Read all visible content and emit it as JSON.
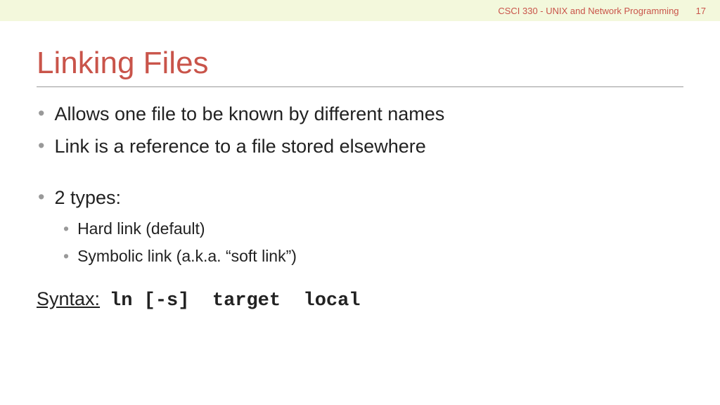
{
  "header": {
    "course": "CSCI 330 - UNIX and Network Programming",
    "page": "17"
  },
  "title": "Linking Files",
  "bullets": {
    "b1": "Allows one file to be known by different names",
    "b2": "Link is a reference to a file stored elsewhere",
    "b3": "2 types:",
    "sub1": "Hard link (default)",
    "sub2": "Symbolic link (a.k.a. “soft link”)"
  },
  "syntax": {
    "label": "Syntax:",
    "code": "ln [-s]  target  local"
  }
}
